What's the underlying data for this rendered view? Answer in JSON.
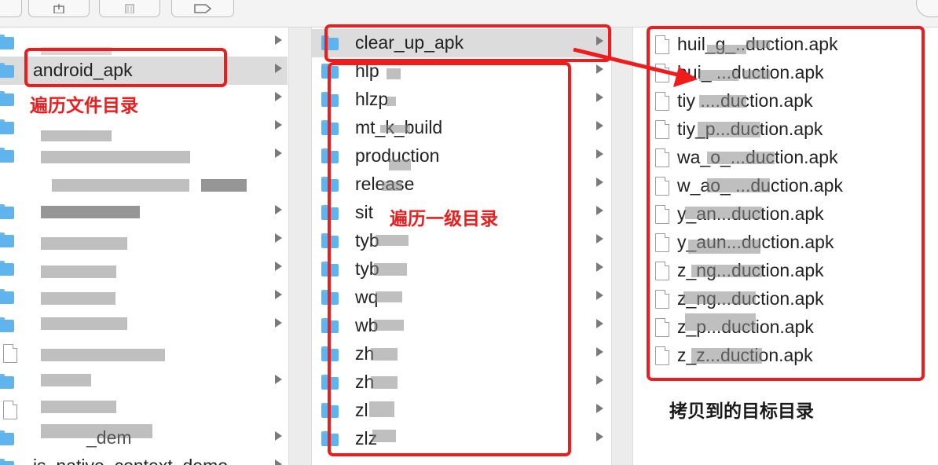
{
  "toolbar": {
    "buttons": [
      "share-icon",
      "trash-icon",
      "tag-icon"
    ]
  },
  "col1": {
    "selected": "android_apk",
    "bottom_item": "js_native_context_demo",
    "demo_fragment": "_dem"
  },
  "col2": {
    "items": [
      "clear_up_apk",
      "hlp",
      "hlzp",
      "mt_k_build",
      "production",
      "release",
      "sit",
      "tyb",
      "tyb",
      "wq",
      "wb",
      "zh",
      "zh",
      "zl",
      "zlz"
    ]
  },
  "col3": {
    "items": [
      "huil_g_..duction.apk",
      "hui_ ...duction.apk",
      "tiy ....duction.apk",
      "tiy_p...duction.apk",
      "wa_o_...duction.apk",
      "w_ao_ ...duction.apk",
      "y_an...duction.apk",
      "y_aun...duction.apk",
      "z_ng...duction.apk",
      "z_ng...duction.apk",
      "z_p...duction.apk",
      "z_z...duction.apk"
    ]
  },
  "annotations": {
    "traverse_files": "遍历文件目录",
    "traverse_level1": "遍历一级目录",
    "copy_target": "拷贝到的目标目录"
  },
  "colors": {
    "annotation_red": "#ee1c1c",
    "folder_blue": "#5fb4ee"
  }
}
